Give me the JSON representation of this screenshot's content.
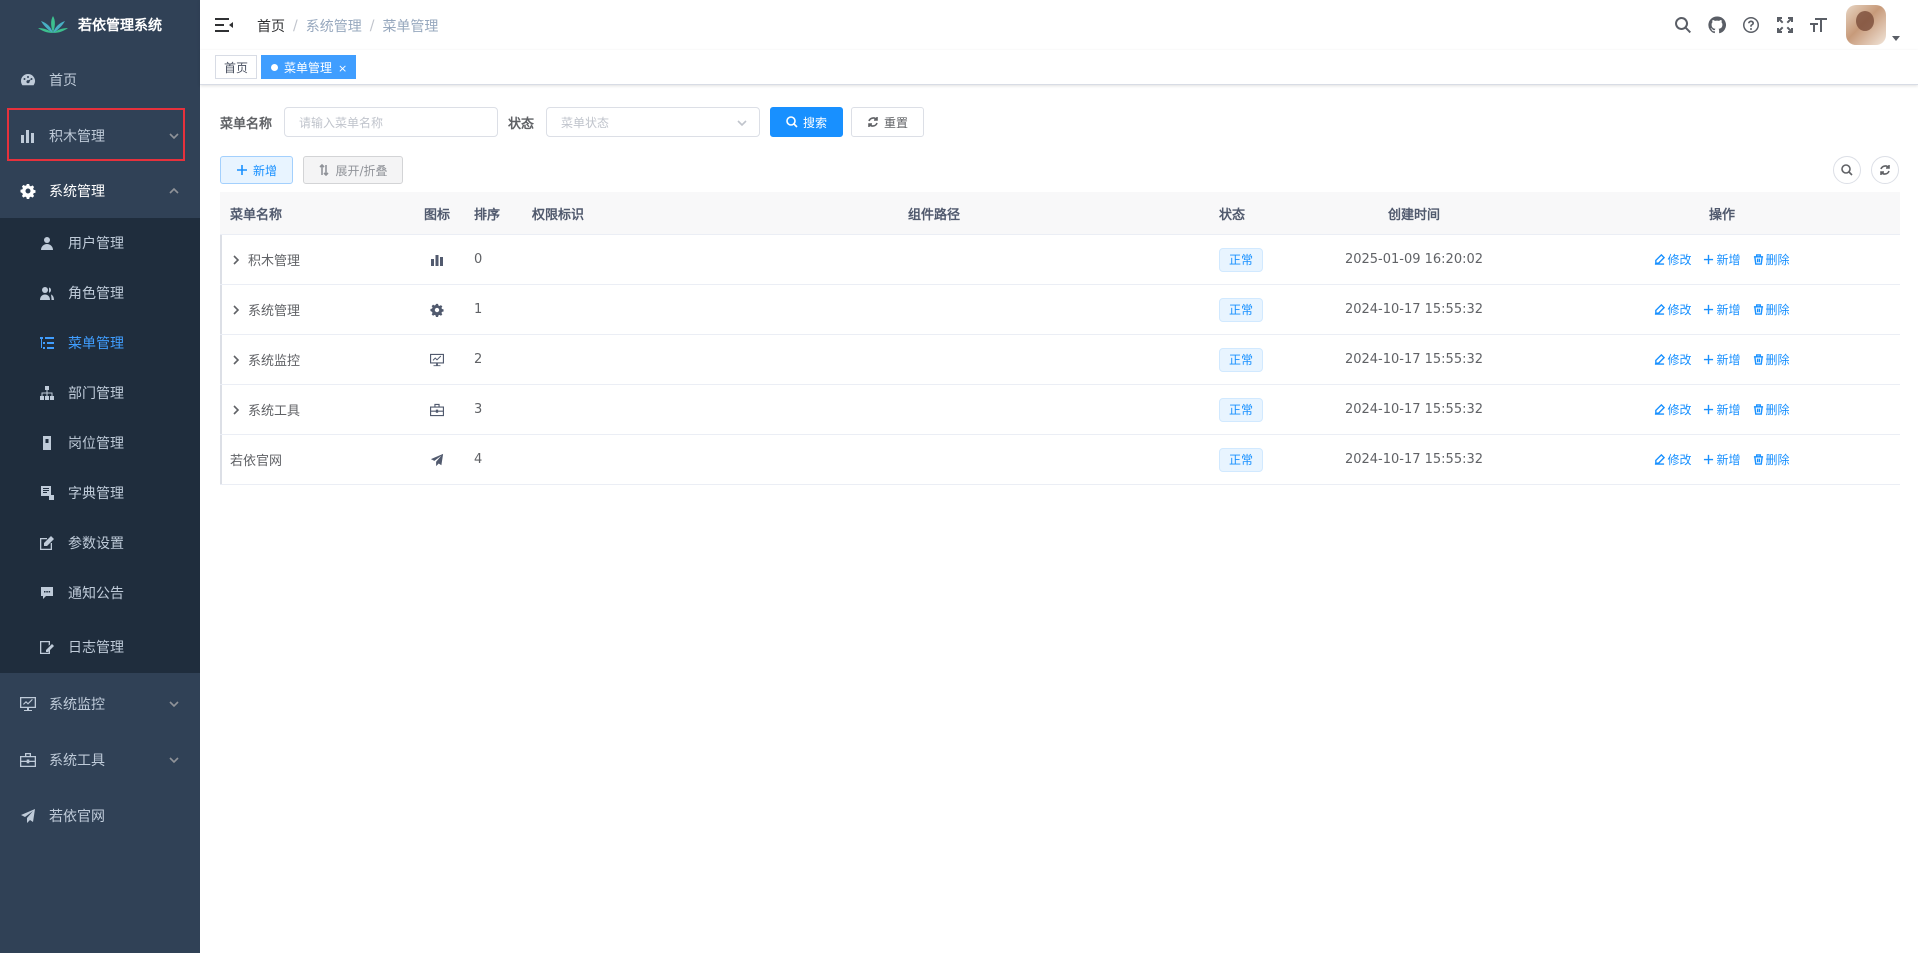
{
  "app": {
    "title": "若依管理系统"
  },
  "sidebar": {
    "items": [
      {
        "label": "首页",
        "icon": "dashboard-icon"
      },
      {
        "label": "积木管理",
        "icon": "chart-icon"
      },
      {
        "label": "系统管理",
        "icon": "gear-icon"
      },
      {
        "label": "系统监控",
        "icon": "monitor-icon"
      },
      {
        "label": "系统工具",
        "icon": "toolbox-icon"
      },
      {
        "label": "若依官网",
        "icon": "send-icon"
      }
    ],
    "sub_items": [
      {
        "label": "用户管理",
        "icon": "user-icon"
      },
      {
        "label": "角色管理",
        "icon": "peoples-icon"
      },
      {
        "label": "菜单管理",
        "icon": "tree-table-icon"
      },
      {
        "label": "部门管理",
        "icon": "tree-icon"
      },
      {
        "label": "岗位管理",
        "icon": "post-icon"
      },
      {
        "label": "字典管理",
        "icon": "dict-icon"
      },
      {
        "label": "参数设置",
        "icon": "edit-icon"
      },
      {
        "label": "通知公告",
        "icon": "message-icon"
      },
      {
        "label": "日志管理",
        "icon": "log-icon"
      }
    ]
  },
  "header": {
    "breadcrumb": [
      "首页",
      "系统管理",
      "菜单管理"
    ],
    "breadcrumb_sep": "/"
  },
  "tags": {
    "home": "首页",
    "current": "菜单管理",
    "close": "×"
  },
  "search": {
    "name_label": "菜单名称",
    "name_placeholder": "请输入菜单名称",
    "status_label": "状态",
    "status_placeholder": "菜单状态",
    "search_btn": "搜索",
    "reset_btn": "重置"
  },
  "toolbar": {
    "add_btn": "新增",
    "expand_btn": "展开/折叠"
  },
  "table": {
    "columns": [
      "菜单名称",
      "图标",
      "排序",
      "权限标识",
      "组件路径",
      "状态",
      "创建时间",
      "操作"
    ],
    "rows": [
      {
        "name": "积木管理",
        "icon": "chart-icon",
        "order": "0",
        "perm": "",
        "path": "",
        "status": "正常",
        "time": "2025-01-09 16:20:02",
        "expandable": true
      },
      {
        "name": "系统管理",
        "icon": "gear-icon",
        "order": "1",
        "perm": "",
        "path": "",
        "status": "正常",
        "time": "2024-10-17 15:55:32",
        "expandable": true
      },
      {
        "name": "系统监控",
        "icon": "monitor-icon",
        "order": "2",
        "perm": "",
        "path": "",
        "status": "正常",
        "time": "2024-10-17 15:55:32",
        "expandable": true
      },
      {
        "name": "系统工具",
        "icon": "toolbox-icon",
        "order": "3",
        "perm": "",
        "path": "",
        "status": "正常",
        "time": "2024-10-17 15:55:32",
        "expandable": true
      },
      {
        "name": "若依官网",
        "icon": "send-icon",
        "order": "4",
        "perm": "",
        "path": "",
        "status": "正常",
        "time": "2024-10-17 15:55:32",
        "expandable": false
      }
    ],
    "ops": {
      "edit": "修改",
      "add": "新增",
      "delete": "删除"
    }
  },
  "colors": {
    "sidebar_bg": "#304156",
    "submenu_bg": "#1f2d3d",
    "primary": "#1890ff",
    "active_menu": "#409eff",
    "highlight_box": "#e6313c"
  }
}
